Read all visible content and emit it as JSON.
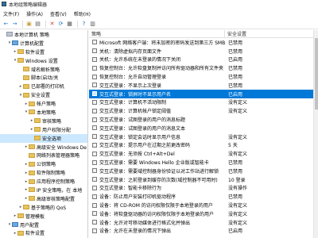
{
  "window": {
    "title": "本地组策略编辑器"
  },
  "menu": [
    "文件(F)",
    "操作(A)",
    "查看(V)",
    "帮助(H)"
  ],
  "toolbar": {
    "buttons": [
      {
        "name": "back-icon",
        "glyph": "←",
        "color": "#1a73c6"
      },
      {
        "name": "forward-icon",
        "glyph": "→",
        "color": "#1a73c6"
      },
      {
        "name": "up-folder-icon",
        "glyph": "▣",
        "color": "#c8a23d"
      },
      {
        "name": "show-hide-tree-icon",
        "glyph": "▤",
        "color": "#555555"
      },
      {
        "name": "delete-icon",
        "glyph": "✕",
        "color": "#d23b2d"
      },
      {
        "name": "refresh-icon",
        "glyph": "⟳",
        "color": "#1a73c6"
      },
      {
        "name": "export-icon",
        "glyph": "▦",
        "color": "#555555"
      },
      {
        "name": "help-icon",
        "glyph": "?",
        "color": "#1a73c6"
      },
      {
        "name": "properties-icon",
        "glyph": "▥",
        "color": "#555555"
      }
    ]
  },
  "tree": [
    {
      "label": "本地计算机 策略",
      "level": 0,
      "twisty": "",
      "icon": "gray"
    },
    {
      "label": "计算机配置",
      "level": 1,
      "twisty": "v",
      "icon": "blue"
    },
    {
      "label": "软件设置",
      "level": 2,
      "twisty": ">",
      "icon": "yellow"
    },
    {
      "label": "Windows 设置",
      "level": 2,
      "twisty": "v",
      "icon": "yellow"
    },
    {
      "label": "域名解析策略",
      "level": 3,
      "twisty": "",
      "icon": "yellow"
    },
    {
      "label": "脚本(启动/关",
      "level": 3,
      "twisty": "",
      "icon": "yellow"
    },
    {
      "label": "已部署的打印机",
      "level": 3,
      "twisty": ">",
      "icon": "yellow"
    },
    {
      "label": "安全设置",
      "level": 3,
      "twisty": "v",
      "icon": "yellow"
    },
    {
      "label": "帐户策略",
      "level": 4,
      "twisty": ">",
      "icon": "yellow"
    },
    {
      "label": "本地策略",
      "level": 4,
      "twisty": "v",
      "icon": "yellow"
    },
    {
      "label": "审核策略",
      "level": 5,
      "twisty": ">",
      "icon": "yellow"
    },
    {
      "label": "用户权限分配",
      "level": 5,
      "twisty": ">",
      "icon": "yellow"
    },
    {
      "label": "安全选项",
      "level": 5,
      "twisty": "",
      "icon": "yellow",
      "selected": true
    },
    {
      "label": "高级安全 Windows De",
      "level": 4,
      "twisty": ">",
      "icon": "yellow"
    },
    {
      "label": "网络列表管理器策略",
      "level": 4,
      "twisty": "",
      "icon": "yellow"
    },
    {
      "label": "公钥策略",
      "level": 4,
      "twisty": ">",
      "icon": "yellow"
    },
    {
      "label": "软件限制策略",
      "level": 4,
      "twisty": ">",
      "icon": "yellow"
    },
    {
      "label": "应用程序控制策略",
      "level": 4,
      "twisty": ">",
      "icon": "yellow"
    },
    {
      "label": "IP 安全策略，在 本地",
      "level": 4,
      "twisty": ">",
      "icon": "yellow"
    },
    {
      "label": "高级审核策略配置",
      "level": 4,
      "twisty": ">",
      "icon": "yellow"
    },
    {
      "label": "基于策略的 QoS",
      "level": 3,
      "twisty": ">",
      "icon": "yellow"
    },
    {
      "label": "管理模板",
      "level": 2,
      "twisty": ">",
      "icon": "yellow"
    },
    {
      "label": "用户配置",
      "level": 1,
      "twisty": "v",
      "icon": "blue"
    },
    {
      "label": "软件设置",
      "level": 2,
      "twisty": ">",
      "icon": "yellow"
    }
  ],
  "columns": {
    "policy": "策略",
    "setting": "安全设置"
  },
  "rows": [
    {
      "policy": "Microsoft 网络客户端：将未加密的密码发送到第三方 SMB...",
      "setting": "已禁用"
    },
    {
      "policy": "关机：清除虚拟内存页面文件",
      "setting": "已禁用"
    },
    {
      "policy": "关机：允许系统在未登录的情况下关闭",
      "setting": "已启用"
    },
    {
      "policy": "恢复控制台：允许软盘复制并访问所有驱动器和所有文件夹",
      "setting": "已禁用"
    },
    {
      "policy": "恢复控制台：允许自动管理登录",
      "setting": "已禁用"
    },
    {
      "policy": "交互式登录：不显示上次登录",
      "setting": "已禁用"
    },
    {
      "policy": "交互式登录：锁屏时不显示用户名",
      "setting": "已启用",
      "selected": true
    },
    {
      "policy": "交互式登录：计算机不活动限制",
      "setting": "没有定义"
    },
    {
      "policy": "交互式登录：计算机帐户锁定阈值",
      "setting": "没有定义"
    },
    {
      "policy": "交互式登录：试图登录的用户的消息标题",
      "setting": ""
    },
    {
      "policy": "交互式登录：试图登录的用户的消息文本",
      "setting": ""
    },
    {
      "policy": "交互式登录：锁定会话时显示用户信息",
      "setting": "没有定义"
    },
    {
      "policy": "交互式登录：提示用户在过期之前更改密码",
      "setting": "5 天"
    },
    {
      "policy": "交互式登录：无须按 Ctrl+Alt+Del",
      "setting": "没有定义"
    },
    {
      "policy": "交互式登录：需要 Windows Hello 企业版或智能卡",
      "setting": "已禁用"
    },
    {
      "policy": "交互式登录：需要域控制器身份验证以对工作站进行解锁",
      "setting": "已禁用"
    },
    {
      "policy": "交互式登录：之前登录到缓存的次数(域控制器不可用时)",
      "setting": "10 登录"
    },
    {
      "policy": "交互式登录：智能卡移除行为",
      "setting": "没有操作"
    },
    {
      "policy": "设备：防止用户安装打印机驱动程序",
      "setting": "已禁用"
    },
    {
      "policy": "设备：将 CD-ROM 的访问权限仅限于本地登录的用户",
      "setting": "没有定义"
    },
    {
      "policy": "设备：将软盘驱动器的访问权限仅限于本地登录的用户",
      "setting": "没有定义"
    },
    {
      "policy": "设备：允许对可移动媒体进行格式化并弹出",
      "setting": "没有定义"
    },
    {
      "policy": "设备：允许在未登录的情况下弹出",
      "setting": "已启用"
    }
  ]
}
